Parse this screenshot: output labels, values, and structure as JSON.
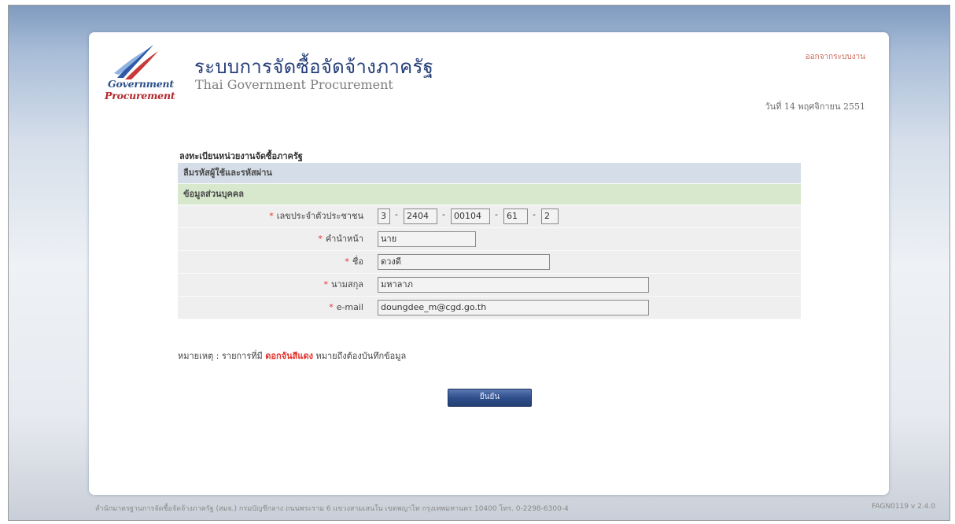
{
  "header": {
    "logo_line1": "Government",
    "logo_line2": "Procurement",
    "title_th": "ระบบการจัดซื้อจัดจ้างภาครัฐ",
    "title_en": "Thai Government Procurement",
    "logout_label": "ออกจากระบบงาน",
    "date_text": "วันที่ 14 พฤศจิกายน 2551"
  },
  "form": {
    "section_title": "ลงทะเบียนหน่วยงานจัดซื้อภาครัฐ",
    "bar_forgot": "ลืมรหัสผู้ใช้และรหัสผ่าน",
    "bar_personal": "ข้อมูลส่วนบุคคล",
    "required_mark": "*",
    "fields": {
      "id_number": {
        "label": "เลขประจำตัวประชาชน",
        "parts": [
          "3",
          "2404",
          "00104",
          "61",
          "2"
        ]
      },
      "prefix": {
        "label": "คำนำหน้า",
        "value": "นาย"
      },
      "first_name": {
        "label": "ชื่อ",
        "value": "ดวงดี"
      },
      "last_name": {
        "label": "นามสกุล",
        "value": "มหาลาภ"
      },
      "email": {
        "label": "e-mail",
        "value": "doungdee_m@cgd.go.th"
      }
    },
    "separator": "-",
    "note_prefix": "หมายเหตุ : รายการที่มี",
    "note_highlight": "ดอกจันสีแดง",
    "note_suffix": "หมายถึงต้องบันทึกข้อมูล",
    "submit_label": "ยืนยัน"
  },
  "footer": {
    "address": "สำนักมาตรฐานการจัดซื้อจัดจ้างภาครัฐ (สมจ.) กรมบัญชีกลาง ถนนพระราม 6 แขวงสามเสนใน เขตพญาไท กรุงเทพมหานคร 10400 โทร. 0-2298-6300-4",
    "version": "FAGN0119 v 2.4.0"
  },
  "colors": {
    "title_blue": "#243d78",
    "required_red": "#e23434",
    "bar_blue": "#d4dde8",
    "bar_green": "#d7e8cc",
    "button_blue": "#2f4f8c"
  }
}
